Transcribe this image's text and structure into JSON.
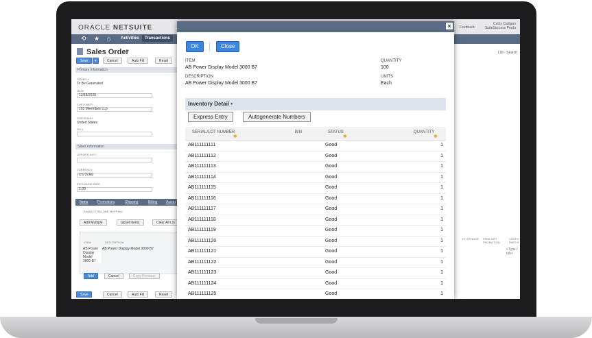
{
  "app": {
    "logo_left": "ORACLE",
    "logo_right": "NETSUITE",
    "feedback": "Feedback",
    "user_name": "Cathy Cadigan",
    "user_role": "SuiteSuccess Produ"
  },
  "nav": {
    "activities": "Activities",
    "transactions": "Transactions"
  },
  "page": {
    "title": "Sales Order",
    "save": "Save",
    "cancel": "Cancel",
    "auto_fill": "Auto Fill",
    "reset": "Reset",
    "primary_info": "Primary Information",
    "order_label": "ORDER #",
    "order_value": "To Be Generated",
    "date_label": "DATE",
    "date_value": "12/18/2020",
    "customer_label": "CUSTOMER",
    "customer_value": "102 Meembee LLp",
    "subsidiary_label": "SUBSIDIARY",
    "subsidiary_value": "United States",
    "po_label": "PO #",
    "sales_info": "Sales Information",
    "opportunity_label": "OPPORTUNITY",
    "currency_label": "CURRENCY",
    "currency_value": "US Dollar",
    "exchange_label": "EXCHANGE RATE",
    "exchange_value": "1.00",
    "tabs": [
      "Items",
      "Promotions",
      "Shipping",
      "Billing",
      "Accou"
    ],
    "enable_shipping": "ENABLE ITEM LINE SHIPPING",
    "add_multiple": "Add Multiple",
    "upsell": "Upsell Items",
    "clear_all": "Clear All Lin",
    "item_col": "ITEM",
    "desc_col": "DESCRIPTION",
    "item_cell": "AB Power Display Model 3000 B7",
    "desc_cell": "AB Power Display Model 3000 B7",
    "add": "Add",
    "cancel_line": "Cancel",
    "copy_previous": "Copy Previous",
    "list": "List",
    "search": "Search",
    "po_vendor": "PO VENDOR",
    "free_gift": "FREE GIFT PROMOTION",
    "custom": "CUSTO PART N",
    "type_to": "<Type t tab>"
  },
  "modal": {
    "ok": "OK",
    "close": "Close",
    "item_label": "ITEM",
    "item_value": "AB Power Display Model 3000 B7",
    "quantity_label": "QUANTITY",
    "quantity_value": "100",
    "description_label": "DESCRIPTION",
    "description_value": "AB Power Display Model 3000 B7",
    "units_label": "UNITS",
    "units_value": "Each",
    "inventory_title": "Inventory Detail",
    "express_entry": "Express Entry",
    "autogenerate": "Autogenerate Numbers",
    "columns": [
      "SERIAL/LOT NUMBER",
      "BIN",
      "STATUS",
      "QUANTITY"
    ],
    "rows": [
      {
        "serial": "AB111111111",
        "status": "Good",
        "qty": "1"
      },
      {
        "serial": "AB111111112",
        "status": "Good",
        "qty": "1"
      },
      {
        "serial": "AB111111113",
        "status": "Good",
        "qty": "1"
      },
      {
        "serial": "AB111111114",
        "status": "Good",
        "qty": "1"
      },
      {
        "serial": "AB111111115",
        "status": "Good",
        "qty": "1"
      },
      {
        "serial": "AB111111116",
        "status": "Good",
        "qty": "1"
      },
      {
        "serial": "AB111111117",
        "status": "Good",
        "qty": "1"
      },
      {
        "serial": "AB111111118",
        "status": "Good",
        "qty": "1"
      },
      {
        "serial": "AB111111119",
        "status": "Good",
        "qty": "1"
      },
      {
        "serial": "AB111111120",
        "status": "Good",
        "qty": "1"
      },
      {
        "serial": "AB111111121",
        "status": "Good",
        "qty": "1"
      },
      {
        "serial": "AB111111122",
        "status": "Good",
        "qty": "1"
      },
      {
        "serial": "AB111111123",
        "status": "Good",
        "qty": "1"
      },
      {
        "serial": "AB111111124",
        "status": "Good",
        "qty": "1"
      },
      {
        "serial": "AB111111125",
        "status": "Good",
        "qty": "1"
      }
    ]
  },
  "colors": {
    "nav": "#5a6b85",
    "accent_blue": "#3e86e0",
    "required": "#f0a020"
  }
}
